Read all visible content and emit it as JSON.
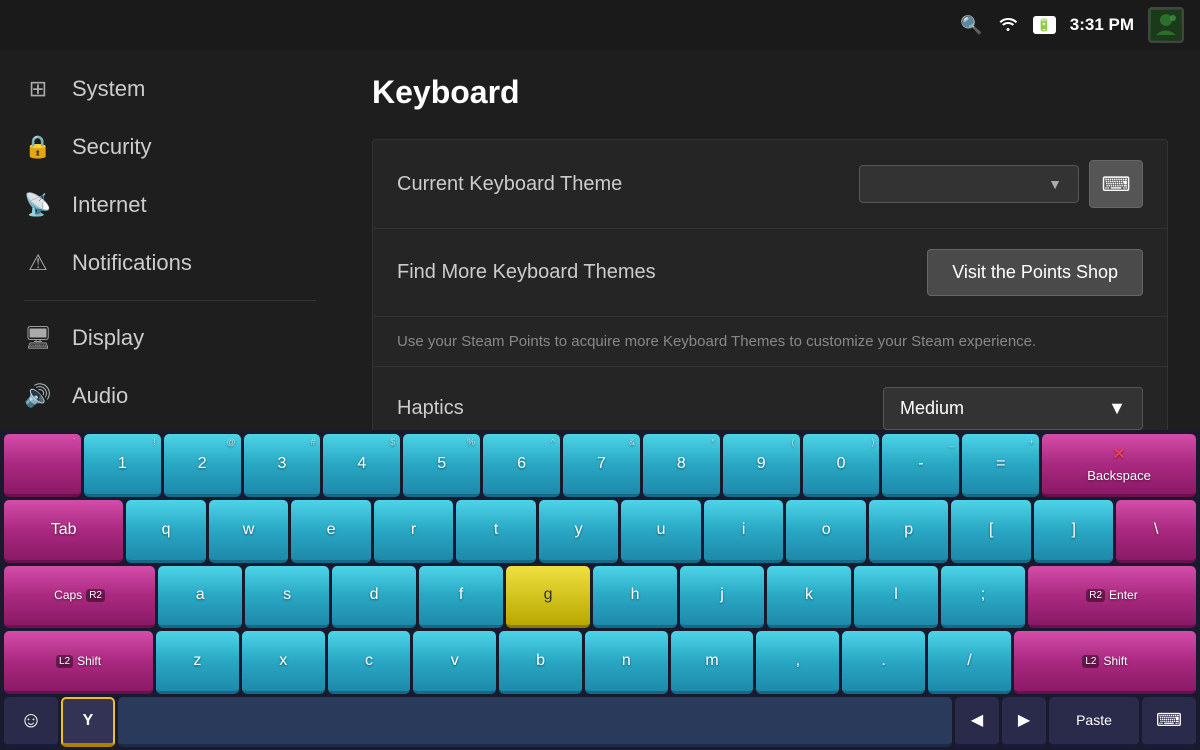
{
  "statusBar": {
    "time": "3:31 PM",
    "searchIcon": "🔍",
    "wifiIcon": "📶",
    "batteryText": "⚡"
  },
  "sidebar": {
    "items": [
      {
        "id": "system",
        "label": "System",
        "icon": "⊞"
      },
      {
        "id": "security",
        "label": "Security",
        "icon": "🔒"
      },
      {
        "id": "internet",
        "label": "Internet",
        "icon": "📡"
      },
      {
        "id": "notifications",
        "label": "Notifications",
        "icon": "⚠"
      },
      {
        "id": "display",
        "label": "Display",
        "icon": "🖥"
      },
      {
        "id": "audio",
        "label": "Audio",
        "icon": "🔊"
      }
    ]
  },
  "mainContent": {
    "pageTitle": "Keyboard",
    "rows": [
      {
        "id": "keyboard-theme",
        "label": "Current Keyboard Theme",
        "dropdownValue": "",
        "hasPreviewBtn": true
      },
      {
        "id": "find-more",
        "label": "Find More Keyboard Themes",
        "btnLabel": "Visit the Points Shop"
      },
      {
        "id": "description",
        "text": "Use your Steam Points to acquire more Keyboard Themes to customize your Steam experience."
      },
      {
        "id": "haptics",
        "label": "Haptics",
        "dropdownValue": "Medium"
      }
    ]
  },
  "keyboard": {
    "row1": [
      "1",
      "2",
      "3",
      "4",
      "5",
      "6",
      "7",
      "8",
      "9",
      "0",
      "-",
      "="
    ],
    "row1secondary": [
      "`",
      "!",
      "@",
      "#",
      "$",
      "%",
      "^",
      "&",
      "*",
      "(",
      ")",
      "_",
      "+"
    ],
    "row2": [
      "q",
      "w",
      "e",
      "r",
      "t",
      "y",
      "u",
      "i",
      "o",
      "p",
      "[",
      "]",
      "\\"
    ],
    "row3": [
      "a",
      "s",
      "d",
      "f",
      "g",
      "h",
      "j",
      "k",
      "l",
      ";"
    ],
    "row4": [
      "z",
      "x",
      "c",
      "v",
      "b",
      "n",
      "m",
      ",",
      "."
    ],
    "specialKeys": {
      "backspace": "Backspace",
      "tab": "Tab",
      "capslock": "Caps",
      "enter": "Enter",
      "shiftLeft": "Shift",
      "shiftRight": "Shift",
      "paste": "Paste"
    }
  }
}
